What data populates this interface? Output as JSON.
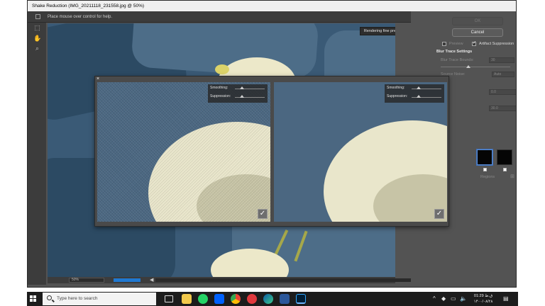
{
  "window": {
    "title": "Shake Reduction (IMG_20211118_231558.jpg @ 50%)",
    "minimize_glyph": "—",
    "maximize_glyph": "☐",
    "close_glyph": "✕"
  },
  "hint_bar": {
    "text": "Place mouse over control for help."
  },
  "canvas": {
    "render_badge": "Rendering fine preview ...",
    "zoom_value": "50%"
  },
  "right_panel": {
    "ok_label": "OK",
    "cancel_label": "Cancel",
    "preview_label": "Preview",
    "artifact_label": "Artifact Suppression",
    "section_title": "Blur Trace Settings",
    "bounds_label": "Blur Trace Bounds:",
    "bounds_value": "30",
    "bounds_unit": "px",
    "noise_label": "Source Noise:",
    "noise_value": "Auto",
    "smoothing_value": "0.0",
    "smoothing_unit": "%",
    "suppression_value": "30.0",
    "suppression_unit": "%",
    "regions_label": "Regions"
  },
  "loupe": {
    "close_glyph": "×",
    "left_pane": {
      "smoothing_label": "Smoothing:",
      "suppression_label": "Suppression:"
    },
    "right_pane": {
      "smoothing_label": "Smoothing:",
      "suppression_label": "Suppression:"
    }
  },
  "taskbar": {
    "search_placeholder": "Type here to search",
    "clock_time": "01:29 ق.ظ",
    "clock_date": "۱۴۰۰/۰۸/۲۸",
    "apps": [
      "task-view",
      "file-explorer",
      "whatsapp",
      "dropbox",
      "chrome",
      "pdf-reader",
      "edge",
      "word",
      "photoshop"
    ]
  },
  "colors": {
    "panel_bg": "#535353",
    "canvas_blue": "#3a5a76",
    "flower_cream": "#ece8c9",
    "accent_blue": "#1f78d1",
    "taskbar_bg": "#1c1c1c"
  }
}
